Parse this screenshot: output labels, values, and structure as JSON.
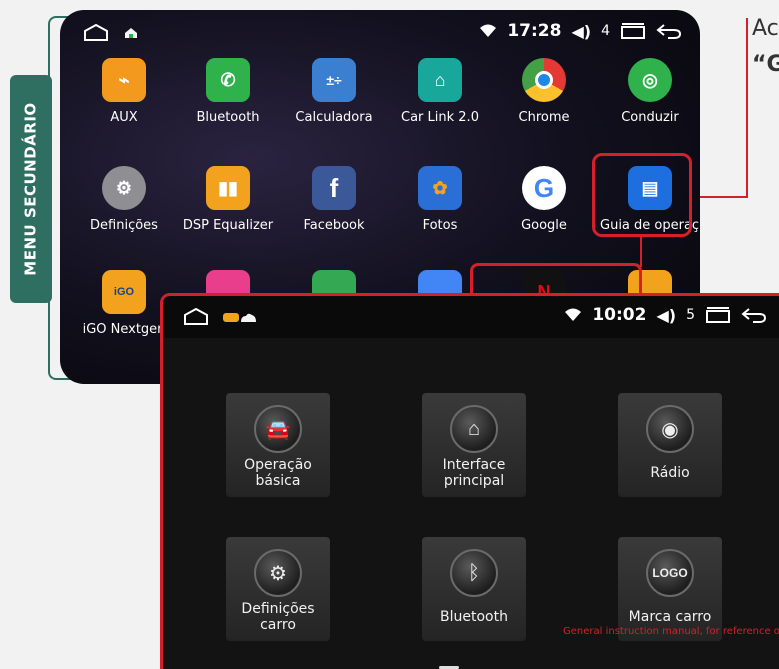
{
  "side_tab": {
    "label": "MENU SECUNDÁRIO"
  },
  "annotation": {
    "line1": "Ac",
    "line2": "“G"
  },
  "top_screen": {
    "status": {
      "time": "17:28",
      "volume": "4"
    },
    "apps": [
      {
        "label": "AUX",
        "icon": "aux-icon",
        "color": "#f39a1e"
      },
      {
        "label": "Bluetooth",
        "icon": "phone-icon",
        "color": "#2fb24c"
      },
      {
        "label": "Calculadora",
        "icon": "calculator-icon",
        "color": "#3b7fd1"
      },
      {
        "label": "Car Link 2.0",
        "icon": "carlink-icon",
        "color": "#1aa79b"
      },
      {
        "label": "Chrome",
        "icon": "chrome-icon",
        "color": "#e8eaed"
      },
      {
        "label": "Conduzir",
        "icon": "steering-icon",
        "color": "#2fb24c"
      },
      {
        "label": "Definições",
        "icon": "settings-icon",
        "color": "#8e8e93"
      },
      {
        "label": "DSP Equalizer",
        "icon": "equalizer-icon",
        "color": "#f3a21e"
      },
      {
        "label": "Facebook",
        "icon": "facebook-icon",
        "color": "#3b5998"
      },
      {
        "label": "Fotos",
        "icon": "photos-icon",
        "color": "#2a6fd6"
      },
      {
        "label": "Google",
        "icon": "google-icon",
        "color": "#ffffff"
      },
      {
        "label": "Guia de operaç..",
        "icon": "guide-icon",
        "color": "#1d6fe0"
      },
      {
        "label": "iGO Nextgen",
        "icon": "igo-icon",
        "color": "#f3a21e"
      }
    ]
  },
  "bottom_screen": {
    "status": {
      "time": "10:02",
      "volume": "5"
    },
    "tiles": [
      {
        "label": "Operação básica",
        "icon": "car-icon"
      },
      {
        "label": "Interface principal",
        "icon": "home-icon"
      },
      {
        "label": "Rádio",
        "icon": "radio-icon"
      },
      {
        "label": "Definições carro",
        "icon": "car-settings-icon"
      },
      {
        "label": "Bluetooth",
        "icon": "bluetooth-icon"
      },
      {
        "label": "Marca carro",
        "icon": "logo-icon",
        "glyph": "LOGO"
      }
    ],
    "footnote": "General instruction manual, for reference only"
  },
  "colors": {
    "accent_red": "#d4202a",
    "tab_green": "#2f6f62"
  }
}
